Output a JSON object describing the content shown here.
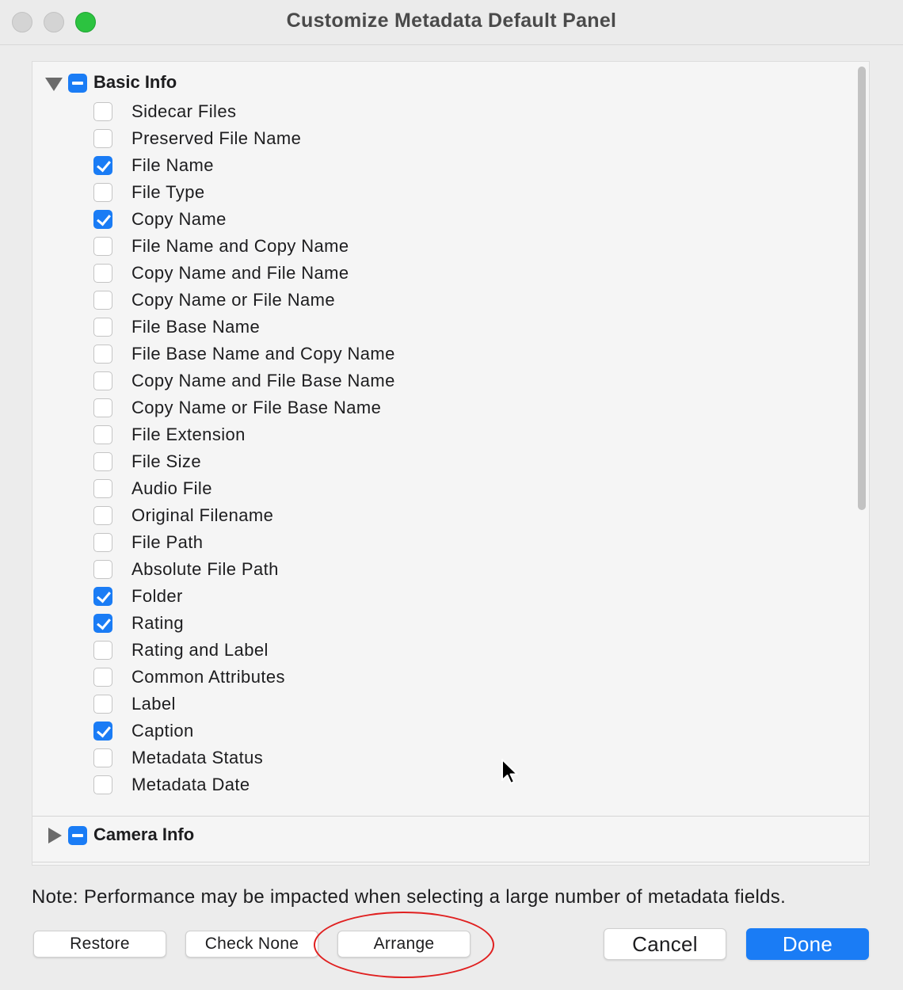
{
  "window": {
    "title": "Customize Metadata Default Panel"
  },
  "sections": [
    {
      "label": "Basic Info",
      "expanded": true,
      "state": "mixed",
      "items": [
        {
          "label": "Sidecar Files",
          "checked": false
        },
        {
          "label": "Preserved File Name",
          "checked": false
        },
        {
          "label": "File Name",
          "checked": true
        },
        {
          "label": "File Type",
          "checked": false
        },
        {
          "label": "Copy Name",
          "checked": true
        },
        {
          "label": "File Name and Copy Name",
          "checked": false
        },
        {
          "label": "Copy Name and File Name",
          "checked": false
        },
        {
          "label": "Copy Name or File Name",
          "checked": false
        },
        {
          "label": "File Base Name",
          "checked": false
        },
        {
          "label": "File Base Name and Copy Name",
          "checked": false
        },
        {
          "label": "Copy Name and File Base Name",
          "checked": false
        },
        {
          "label": "Copy Name or File Base Name",
          "checked": false
        },
        {
          "label": "File Extension",
          "checked": false
        },
        {
          "label": "File Size",
          "checked": false
        },
        {
          "label": "Audio File",
          "checked": false
        },
        {
          "label": "Original Filename",
          "checked": false
        },
        {
          "label": "File Path",
          "checked": false
        },
        {
          "label": "Absolute File Path",
          "checked": false
        },
        {
          "label": "Folder",
          "checked": true
        },
        {
          "label": "Rating",
          "checked": true
        },
        {
          "label": "Rating and Label",
          "checked": false
        },
        {
          "label": "Common Attributes",
          "checked": false
        },
        {
          "label": "Label",
          "checked": false
        },
        {
          "label": "Caption",
          "checked": true
        },
        {
          "label": "Metadata Status",
          "checked": false
        },
        {
          "label": "Metadata Date",
          "checked": false
        }
      ]
    },
    {
      "label": "Camera Info",
      "expanded": false,
      "state": "mixed"
    }
  ],
  "note": "Note: Performance may be impacted when selecting a large number of metadata fields.",
  "buttons": {
    "restore": "Restore",
    "check_none": "Check None",
    "arrange": "Arrange",
    "cancel": "Cancel",
    "done": "Done"
  },
  "colors": {
    "accent": "#1a7cf5",
    "annotation": "#e02020",
    "zoom_button": "#2cc340"
  }
}
